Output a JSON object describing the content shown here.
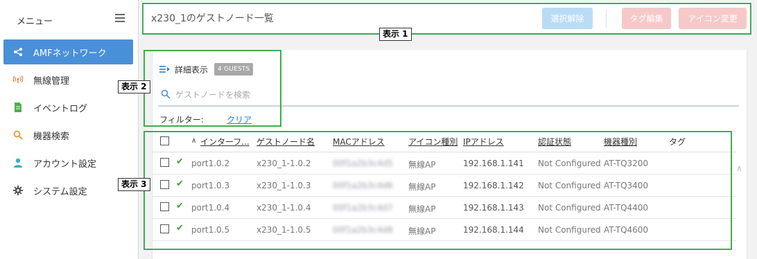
{
  "sidebar": {
    "menu_label": "メニュー",
    "items": [
      {
        "label": "AMFネットワーク",
        "icon": "share-icon",
        "active": true
      },
      {
        "label": "無線管理",
        "icon": "wireless-icon",
        "active": false
      },
      {
        "label": "イベントログ",
        "icon": "document-icon",
        "active": false
      },
      {
        "label": "機器検索",
        "icon": "search-icon",
        "active": false
      },
      {
        "label": "アカウント設定",
        "icon": "user-icon",
        "active": false
      },
      {
        "label": "システム設定",
        "icon": "gear-icon",
        "active": false
      }
    ]
  },
  "header": {
    "title": "x230_1のゲストノード一覧",
    "buttons": {
      "deselect": "選択解除",
      "tag_edit": "タグ編集",
      "icon_change": "アイコン変更"
    }
  },
  "panel": {
    "detail_label": "詳細表示",
    "guest_count_badge": "4 GUESTS",
    "search_placeholder": "ゲストノードを検索",
    "filter_label": "フィルター:",
    "clear_label": "クリア"
  },
  "table": {
    "columns": [
      "インターフ...",
      "ゲストノード名",
      "MACアドレス",
      "アイコン種別",
      "IPアドレス",
      "認証状態",
      "機器種別",
      "タグ"
    ],
    "rows": [
      {
        "interface": "port1.0.2",
        "name": "x230_1-1.0.2",
        "mac": "00f1a2b3c4d5",
        "icon_type": "無線AP",
        "ip": "192.168.1.141",
        "auth": "Not Configured",
        "model": "AT-TQ3200",
        "tag": ""
      },
      {
        "interface": "port1.0.3",
        "name": "x230_1-1.0.3",
        "mac": "00f1a2b3c4d6",
        "icon_type": "無線AP",
        "ip": "192.168.1.142",
        "auth": "Not Configured",
        "model": "AT-TQ3400",
        "tag": ""
      },
      {
        "interface": "port1.0.4",
        "name": "x230_1-1.0.4",
        "mac": "00f1a2b3c4d7",
        "icon_type": "無線AP",
        "ip": "192.168.1.143",
        "auth": "Not Configured",
        "model": "AT-TQ4400",
        "tag": ""
      },
      {
        "interface": "port1.0.5",
        "name": "x230_1-1.0.5",
        "mac": "00f1a2b3c4d8",
        "icon_type": "無線AP",
        "ip": "192.168.1.144",
        "auth": "Not Configured",
        "model": "AT-TQ4600",
        "tag": ""
      }
    ]
  },
  "annotations": {
    "label1": "表示 1",
    "label2": "表示 2",
    "label3": "表示 3"
  },
  "colors": {
    "accent": "#4a90d9",
    "annotation_green": "#3dae4d",
    "check_green": "#3da13d",
    "button_blue": "#b9dcf5",
    "button_pink": "#f6c9c9"
  }
}
